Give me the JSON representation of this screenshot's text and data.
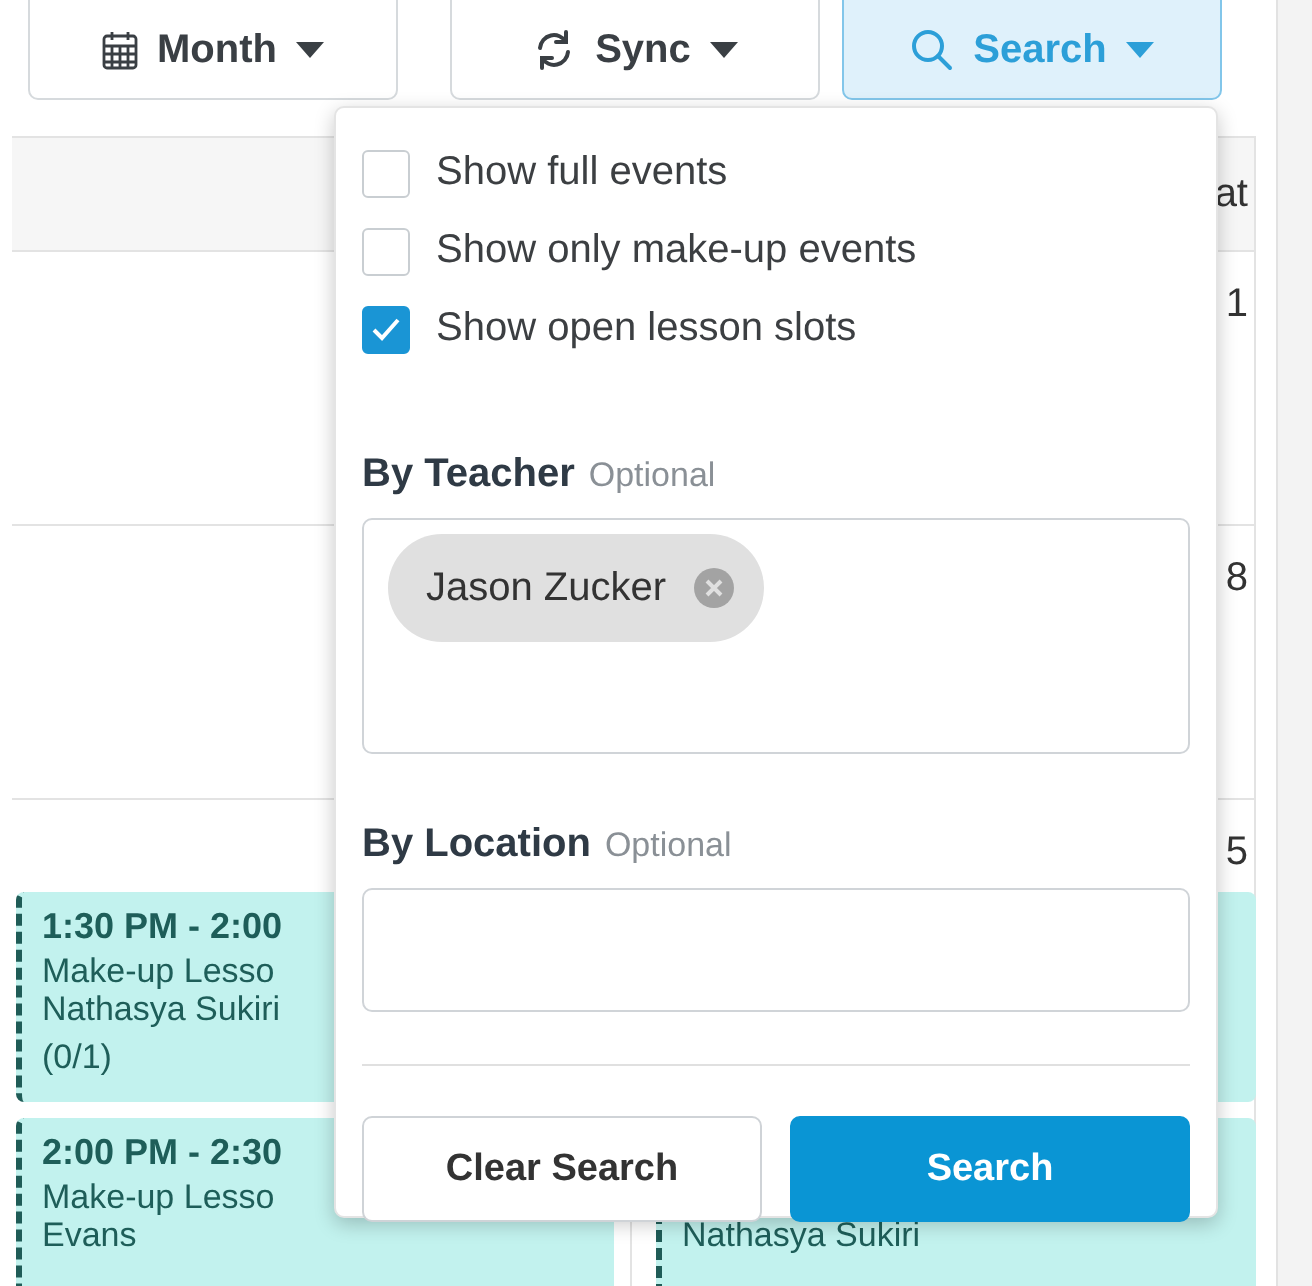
{
  "toolbar": [
    {
      "kind": "calendar",
      "label": "Month",
      "selected": false
    },
    {
      "kind": "sync",
      "label": "Sync",
      "selected": false
    },
    {
      "kind": "search",
      "label": "Search",
      "selected": true
    }
  ],
  "calendar": {
    "header": "at",
    "weeks": [
      {
        "day": "1",
        "cells": [
          {},
          {}
        ]
      },
      {
        "day": "8",
        "cells": [
          {},
          {}
        ]
      },
      {
        "day": "5",
        "cells": [
          {
            "events": [
              {
                "kind": "event",
                "time": "1:30 PM - 2:00",
                "title": "Make-up Lesso",
                "student": "Nathasya Sukiri",
                "count": "(0/1)"
              },
              {
                "kind": "event",
                "time": "2:00 PM - 2:30",
                "title": "Make-up Lesso",
                "student": "Evans"
              }
            ]
          },
          {
            "events": [
              {
                "kind": "event"
              },
              {
                "kind": "event",
                "student": "Nathasya Sukiri"
              }
            ]
          }
        ]
      }
    ]
  },
  "search_panel": {
    "options": [
      {
        "label": "Show full events",
        "checked": false
      },
      {
        "label": "Show only make-up events",
        "checked": false
      },
      {
        "label": "Show open lesson slots",
        "checked": true
      }
    ],
    "teacher": {
      "label": "By Teacher",
      "hint": "Optional",
      "chips": [
        "Jason Zucker"
      ]
    },
    "location": {
      "label": "By Location",
      "hint": "Optional"
    },
    "buttons": [
      {
        "kind": "secondary",
        "label": "Clear Search"
      },
      {
        "kind": "primary",
        "label": "Search"
      }
    ]
  }
}
